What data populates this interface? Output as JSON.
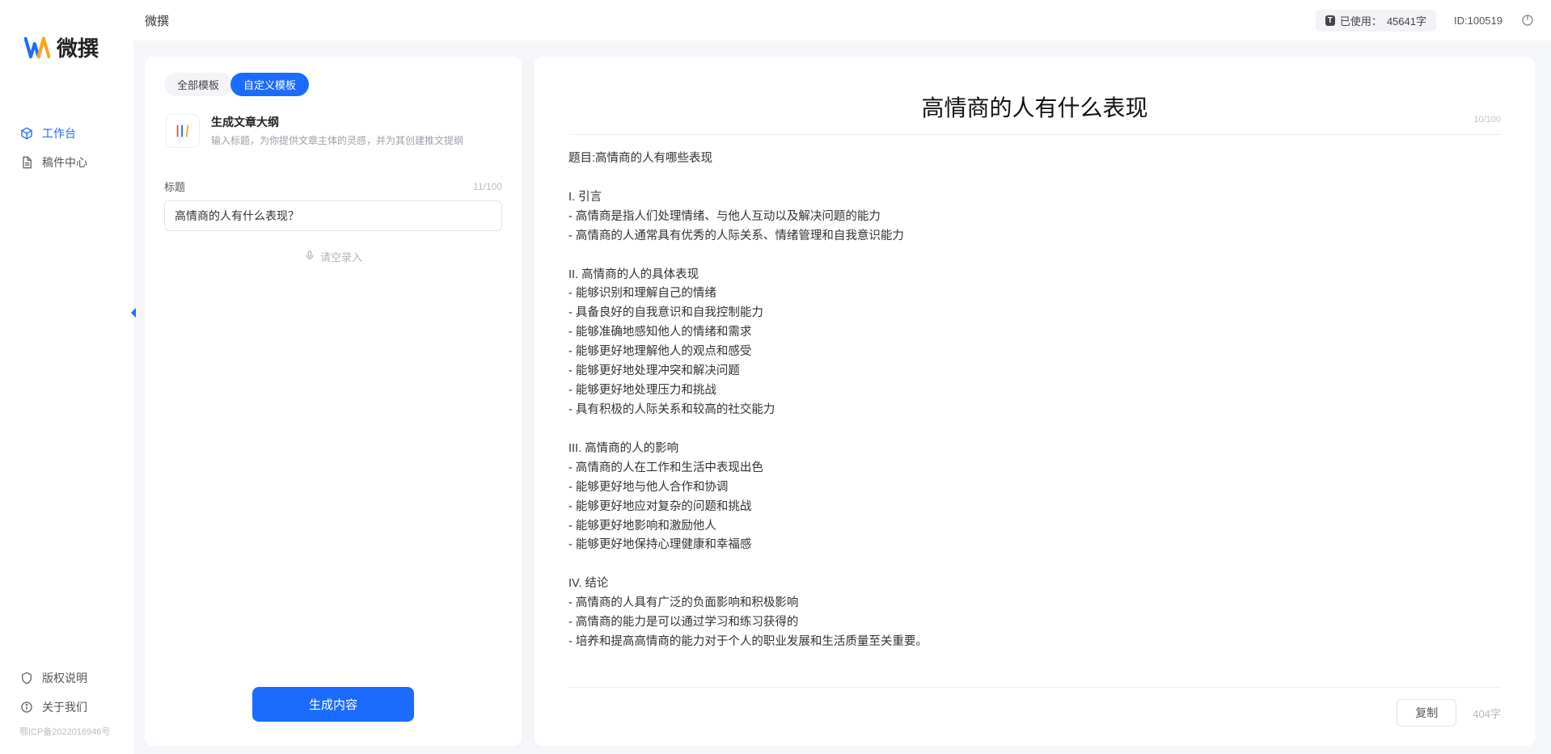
{
  "app": {
    "name": "微撰"
  },
  "topbar": {
    "title": "微撰",
    "usage_label": "已使用：",
    "usage_value": "45641字",
    "id_label": "ID:",
    "id_value": "100519"
  },
  "sidebar": {
    "nav": [
      {
        "label": "工作台"
      },
      {
        "label": "稿件中心"
      }
    ],
    "footer": [
      {
        "label": "版权说明"
      },
      {
        "label": "关于我们"
      }
    ],
    "icp": "鄂ICP备2022016946号"
  },
  "left": {
    "tabs": {
      "all": "全部模板",
      "custom": "自定义模板"
    },
    "template": {
      "title": "生成文章大纲",
      "desc": "输入标题，为你提供文章主体的灵感，并为其创建推文提纲"
    },
    "form": {
      "label": "标题",
      "count": "11/100",
      "value": "高情商的人有什么表现？",
      "voice_hint": "请空录入"
    },
    "generate_btn": "生成内容"
  },
  "doc": {
    "title": "高情商的人有什么表现",
    "title_count": "10/100",
    "body": "题目:高情商的人有哪些表现\n\nI. 引言\n- 高情商是指人们处理情绪、与他人互动以及解决问题的能力\n- 高情商的人通常具有优秀的人际关系、情绪管理和自我意识能力\n\nII. 高情商的人的具体表现\n- 能够识别和理解自己的情绪\n- 具备良好的自我意识和自我控制能力\n- 能够准确地感知他人的情绪和需求\n- 能够更好地理解他人的观点和感受\n- 能够更好地处理冲突和解决问题\n- 能够更好地处理压力和挑战\n- 具有积极的人际关系和较高的社交能力\n\nIII. 高情商的人的影响\n- 高情商的人在工作和生活中表现出色\n- 能够更好地与他人合作和协调\n- 能够更好地应对复杂的问题和挑战\n- 能够更好地影响和激励他人\n- 能够更好地保持心理健康和幸福感\n\nIV. 结论\n- 高情商的人具有广泛的负面影响和积极影响\n- 高情商的能力是可以通过学习和练习获得的\n- 培养和提高高情商的能力对于个人的职业发展和生活质量至关重要。",
    "copy": "复制",
    "wordcount": "404字"
  }
}
